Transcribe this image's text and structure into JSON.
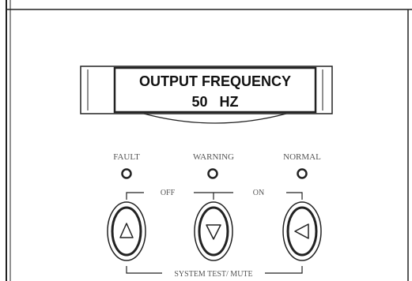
{
  "display": {
    "line1": "OUTPUT FREQUENCY",
    "line2": "50   HZ"
  },
  "indicators": [
    {
      "label": "FAULT"
    },
    {
      "label": "WARNING"
    },
    {
      "label": "NORMAL"
    }
  ],
  "labels": {
    "off": "OFF",
    "on": "ON",
    "system_test": "SYSTEM TEST/ MUTE"
  },
  "buttons": [
    {
      "icon": "triangle-up-icon"
    },
    {
      "icon": "triangle-down-icon"
    },
    {
      "icon": "triangle-left-icon"
    }
  ],
  "colors": {
    "line": "#222222",
    "panel": "#ffffff",
    "label_gray": "#555555"
  }
}
